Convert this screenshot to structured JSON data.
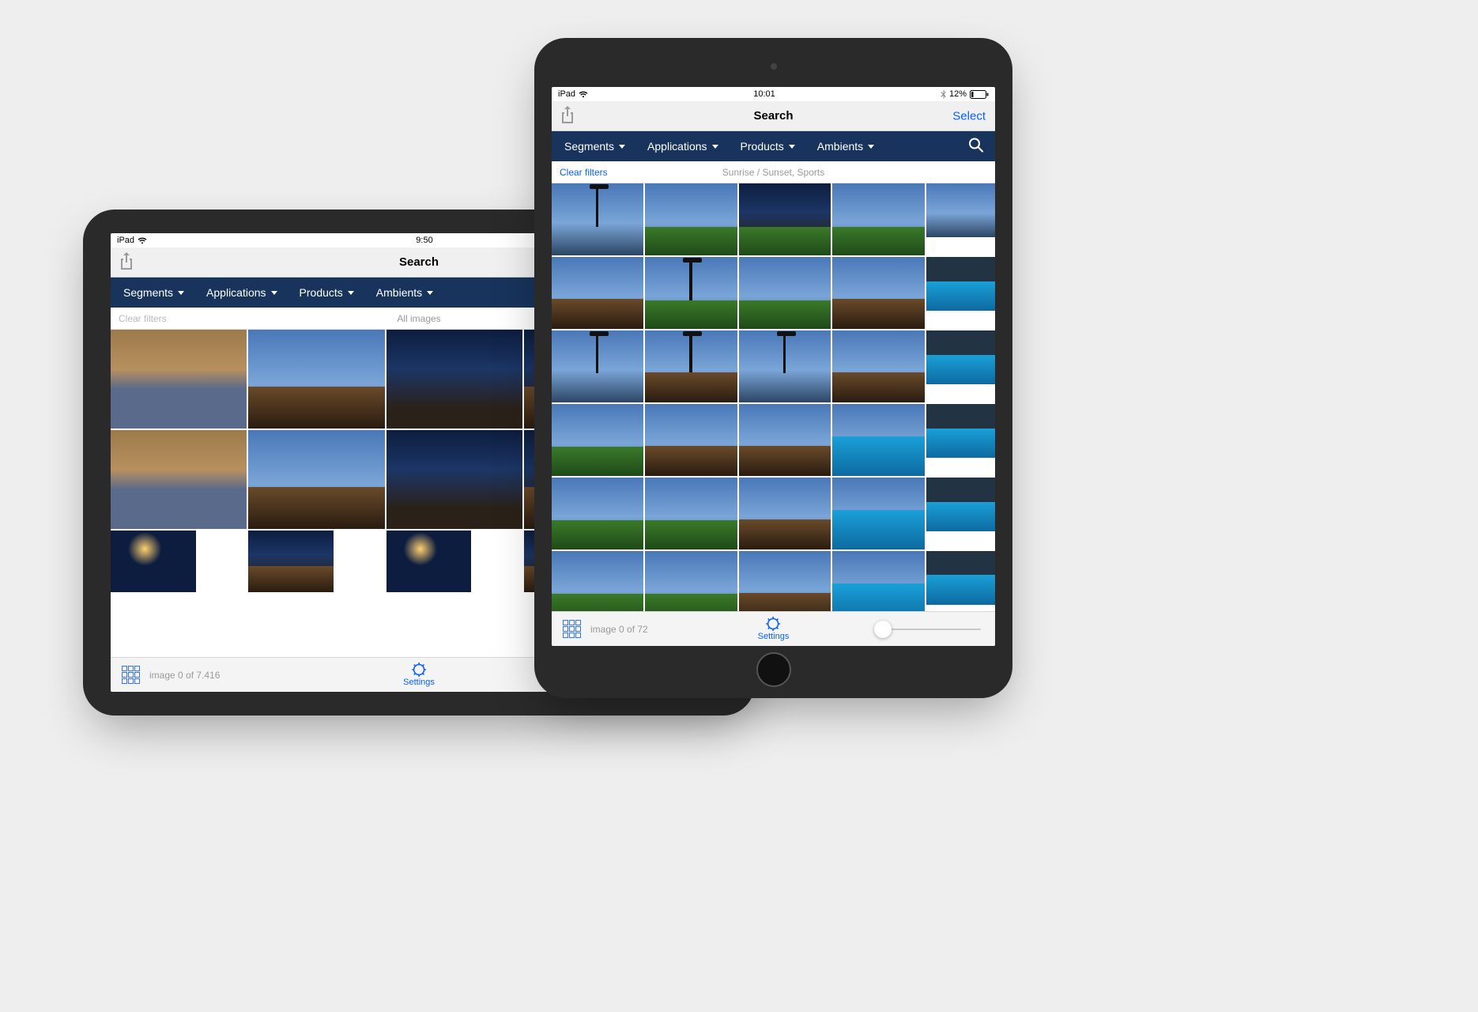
{
  "landscape": {
    "statusbar": {
      "device": "iPad",
      "time": "9:50"
    },
    "navbar": {
      "title": "Search"
    },
    "filters": {
      "segments": "Segments",
      "applications": "Applications",
      "products": "Products",
      "ambients": "Ambients"
    },
    "secondbar": {
      "clear": "Clear filters",
      "applied": "All images"
    },
    "toolbar": {
      "counter": "image 0 of 7.416",
      "settings": "Settings"
    }
  },
  "portrait": {
    "statusbar": {
      "device": "iPad",
      "time": "10:01",
      "battery": "12%"
    },
    "navbar": {
      "title": "Search",
      "select": "Select"
    },
    "filters": {
      "segments": "Segments",
      "applications": "Applications",
      "products": "Products",
      "ambients": "Ambients"
    },
    "secondbar": {
      "clear": "Clear filters",
      "applied": "Sunrise / Sunset, Sports"
    },
    "toolbar": {
      "counter": "image 0 of 72",
      "settings": "Settings"
    }
  }
}
